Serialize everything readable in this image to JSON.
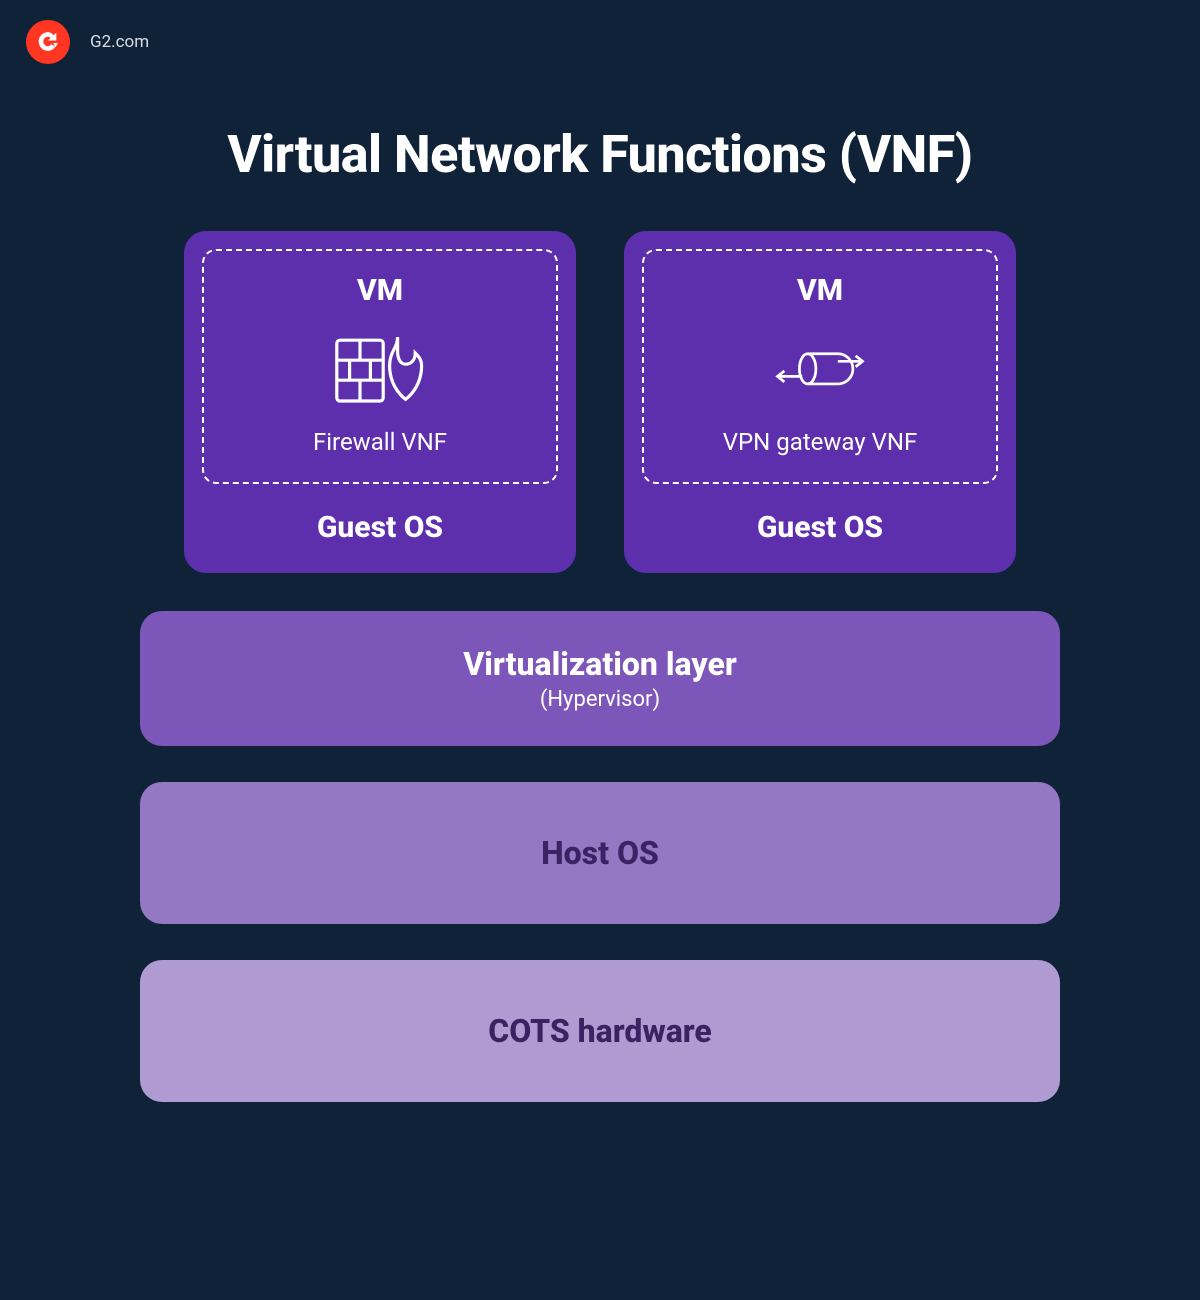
{
  "brand": "G2.com",
  "title": "Virtual Network Functions (VNF)",
  "vms": [
    {
      "vm_label": "VM",
      "vnf_name": "Firewall VNF",
      "guest_os": "Guest OS",
      "icon": "firewall-icon"
    },
    {
      "vm_label": "VM",
      "vnf_name": "VPN gateway VNF",
      "guest_os": "Guest OS",
      "icon": "vpn-gateway-icon"
    }
  ],
  "layers": {
    "virt": {
      "title": "Virtualization layer",
      "sub": "(Hypervisor)"
    },
    "host": {
      "title": "Host OS"
    },
    "cots": {
      "title": "COTS hardware"
    }
  },
  "colors": {
    "background": "#0f2238",
    "vm_card": "#5e2fad",
    "layer_virt": "#7c56b8",
    "layer_host": "#9478c4",
    "layer_cots": "#af9ad1",
    "logo": "#ff3621"
  }
}
